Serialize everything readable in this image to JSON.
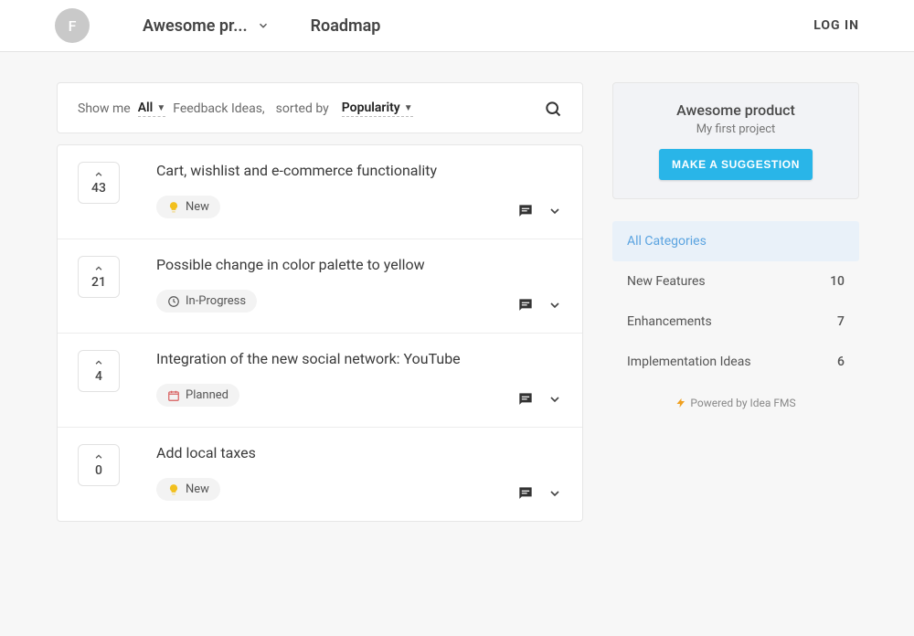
{
  "header": {
    "avatar_initial": "F",
    "project_label": "Awesome pr...",
    "roadmap_label": "Roadmap",
    "login_label": "LOG IN"
  },
  "filters": {
    "show_label": "Show me",
    "type_value": "All",
    "middle_text": "Feedback Ideas,",
    "sort_label": "sorted by",
    "sort_value": "Popularity"
  },
  "ideas": [
    {
      "votes": "43",
      "title": "Cart, wishlist and e-commerce functionality",
      "status": "New",
      "status_icon": "bulb"
    },
    {
      "votes": "21",
      "title": "Possible change in color palette to yellow",
      "status": "In-Progress",
      "status_icon": "clock"
    },
    {
      "votes": "4",
      "title": "Integration of the new social network: YouTube",
      "status": "Planned",
      "status_icon": "calendar"
    },
    {
      "votes": "0",
      "title": "Add local taxes",
      "status": "New",
      "status_icon": "bulb"
    }
  ],
  "sidebar": {
    "project_name": "Awesome product",
    "project_tagline": "My first project",
    "suggest_label": "MAKE A SUGGESTION",
    "categories": [
      {
        "label": "All Categories",
        "count": "",
        "active": true
      },
      {
        "label": "New Features",
        "count": "10",
        "active": false
      },
      {
        "label": "Enhancements",
        "count": "7",
        "active": false
      },
      {
        "label": "Implementation Ideas",
        "count": "6",
        "active": false
      }
    ],
    "powered_text": "Powered by Idea FMS"
  }
}
